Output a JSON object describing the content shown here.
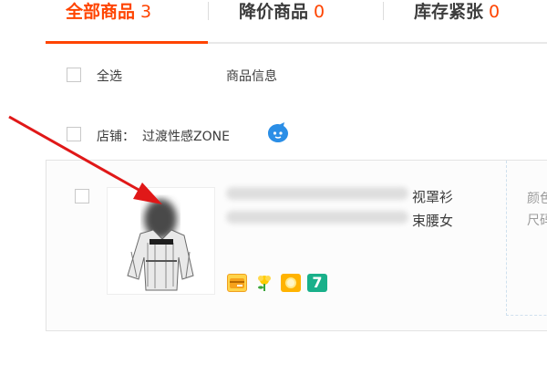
{
  "tabs": [
    {
      "label": "全部商品",
      "count": "3"
    },
    {
      "label": "降价商品",
      "count": "0"
    },
    {
      "label": "库存紧张",
      "count": "0"
    }
  ],
  "header": {
    "select_all": "全选",
    "product_info": "商品信息"
  },
  "shop": {
    "prefix": "店铺：",
    "name": "过渡性感ZONE",
    "chat_icon": "wangwang-chat-icon"
  },
  "item": {
    "title_line1_tail": "视罩衫",
    "title_line2_tail": "束腰女",
    "prop_color": "颜色",
    "prop_size": "尺码",
    "badges": [
      "credit-card-icon",
      "flower-icon",
      "sun-icon",
      "seven-day-return-icon"
    ],
    "badge_seven_text": "7"
  },
  "colors": {
    "accent": "#ff4400",
    "arrow": "#e01818"
  }
}
